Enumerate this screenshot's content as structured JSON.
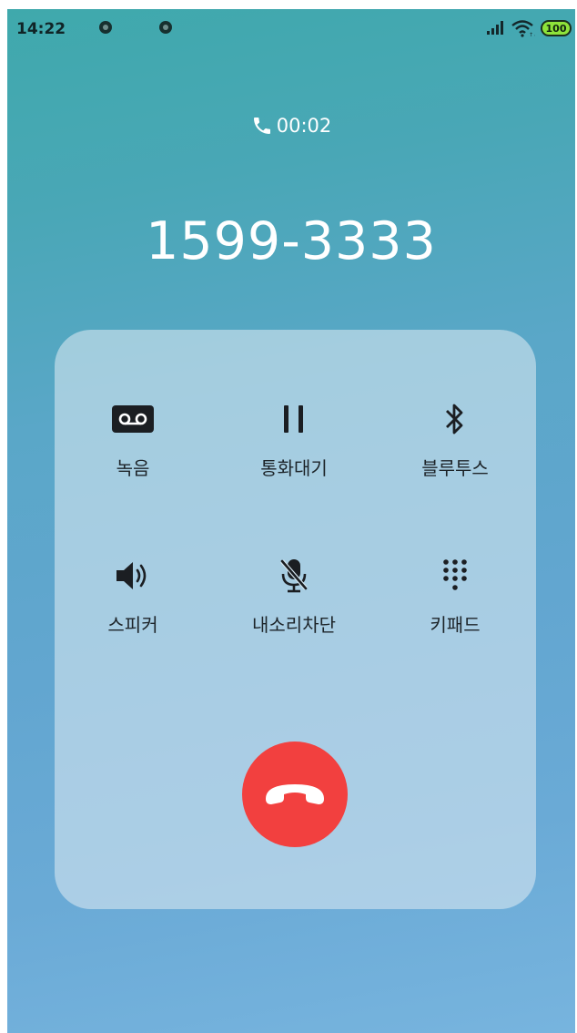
{
  "status_bar": {
    "time": "14:22",
    "battery": "100",
    "icons": [
      "notification-dot-icon",
      "notification-dot-icon",
      "signal-icon",
      "wifi-icon",
      "battery-icon"
    ],
    "battery_color": "#8ee33a"
  },
  "call": {
    "duration": "00:02",
    "number": "1599-3333"
  },
  "controls": [
    {
      "label": "녹음",
      "icon": "voicemail-icon"
    },
    {
      "label": "통화대기",
      "icon": "pause-icon"
    },
    {
      "label": "블루투스",
      "icon": "bluetooth-icon"
    },
    {
      "label": "스피커",
      "icon": "speaker-icon"
    },
    {
      "label": "내소리차단",
      "icon": "mic-off-icon"
    },
    {
      "label": "키패드",
      "icon": "keypad-icon"
    }
  ],
  "end_call": {
    "icon": "end-call-icon",
    "color": "#f2403f"
  },
  "colors": {
    "background_top": "#3fa9ac",
    "background_bottom": "#77b4de",
    "text_light": "#ffffff",
    "text_dark": "#1d2429"
  }
}
